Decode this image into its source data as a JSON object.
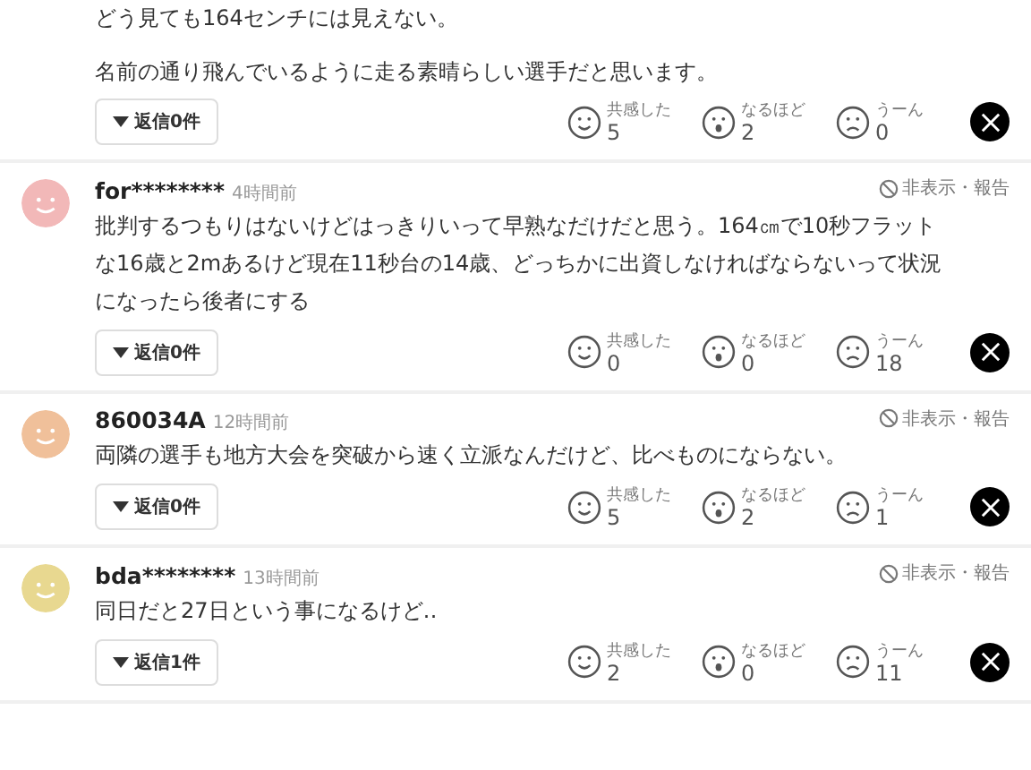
{
  "top_comment": {
    "lines": [
      "どう見ても164センチには見えない。",
      "名前の通り飛んでいるように走る素晴らしい選手だと思います。"
    ],
    "reply_button": "返信0件",
    "reactions": [
      {
        "kind": "smile",
        "label": "共感した",
        "count": "5"
      },
      {
        "kind": "surprise",
        "label": "なるほど",
        "count": "2"
      },
      {
        "kind": "frown",
        "label": "うーん",
        "count": "0"
      }
    ]
  },
  "comments": [
    {
      "user": "for********",
      "time": "4時間前",
      "color": "#f2b8b8",
      "hide_report": "非表示・報告",
      "text": "批判するつもりはないけどはっきりいって早熟なだけだと思う。164㎝で10秒フラットな16歳と2mあるけど現在11秒台の14歳、どっちかに出資しなければならないって状況になったら後者にする",
      "reply_button": "返信0件",
      "reactions": [
        {
          "kind": "smile",
          "label": "共感した",
          "count": "0"
        },
        {
          "kind": "surprise",
          "label": "なるほど",
          "count": "0"
        },
        {
          "kind": "frown",
          "label": "うーん",
          "count": "18"
        }
      ]
    },
    {
      "user": "860034A",
      "time": "12時間前",
      "color": "#f0c09a",
      "hide_report": "非表示・報告",
      "text": "両隣の選手も地方大会を突破から速く立派なんだけど、比べものにならない。",
      "reply_button": "返信0件",
      "reactions": [
        {
          "kind": "smile",
          "label": "共感した",
          "count": "5"
        },
        {
          "kind": "surprise",
          "label": "なるほど",
          "count": "2"
        },
        {
          "kind": "frown",
          "label": "うーん",
          "count": "1"
        }
      ]
    },
    {
      "user": "bda********",
      "time": "13時間前",
      "color": "#e8d890",
      "hide_report": "非表示・報告",
      "text": "同日だと27日という事になるけど‥",
      "reply_button": "返信1件",
      "reactions": [
        {
          "kind": "smile",
          "label": "共感した",
          "count": "2"
        },
        {
          "kind": "surprise",
          "label": "なるほど",
          "count": "0"
        },
        {
          "kind": "frown",
          "label": "うーん",
          "count": "11"
        }
      ]
    }
  ]
}
